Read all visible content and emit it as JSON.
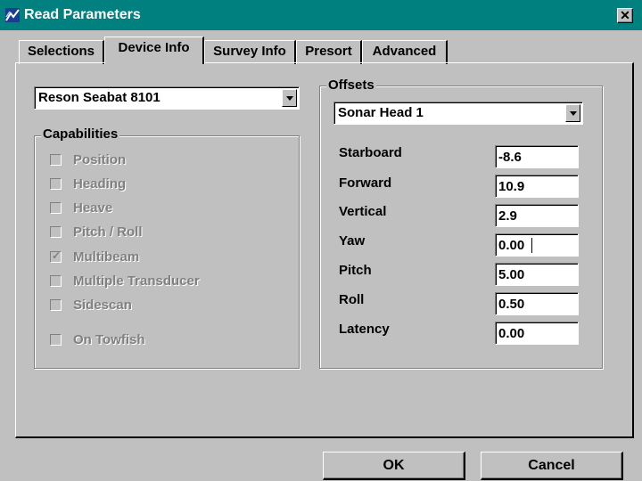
{
  "window": {
    "title": "Read Parameters",
    "close_glyph": "✕",
    "icon": "app-icon",
    "title_color": "#00807f"
  },
  "tabs": [
    {
      "label": "Selections",
      "active": false
    },
    {
      "label": "Device Info",
      "active": true
    },
    {
      "label": "Survey Info",
      "active": false
    },
    {
      "label": "Presort",
      "active": false
    },
    {
      "label": "Advanced",
      "active": false
    }
  ],
  "device": {
    "selected": "Reson Seabat 8101"
  },
  "capabilities": {
    "label": "Capabilities",
    "items": [
      {
        "label": "Position",
        "checked": false
      },
      {
        "label": "Heading",
        "checked": false
      },
      {
        "label": "Heave",
        "checked": false
      },
      {
        "label": "Pitch / Roll",
        "checked": false
      },
      {
        "label": "Multibeam",
        "checked": true
      },
      {
        "label": "Multiple Transducer",
        "checked": false
      },
      {
        "label": "Sidescan",
        "checked": false
      },
      {
        "label": "On Towfish",
        "checked": false
      }
    ],
    "check_glyph": "✓"
  },
  "offsets": {
    "label": "Offsets",
    "selected_head": "Sonar Head 1",
    "fields": [
      {
        "label": "Starboard",
        "value": "-8.6"
      },
      {
        "label": "Forward",
        "value": "10.9"
      },
      {
        "label": "Vertical",
        "value": "2.9"
      },
      {
        "label": "Yaw",
        "value": "0.00"
      },
      {
        "label": "Pitch",
        "value": "5.00"
      },
      {
        "label": "Roll",
        "value": "0.50"
      },
      {
        "label": "Latency",
        "value": "0.00"
      }
    ]
  },
  "buttons": {
    "ok": "OK",
    "cancel": "Cancel"
  }
}
